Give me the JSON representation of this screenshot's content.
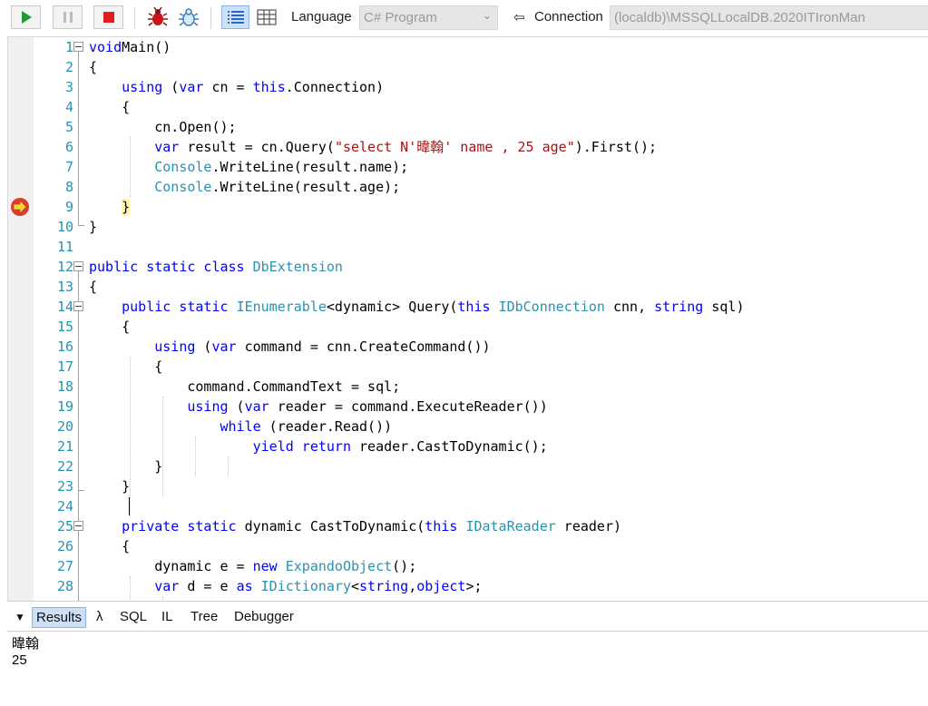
{
  "toolbar": {
    "language_label": "Language",
    "language_value": "C# Program",
    "connection_label": "Connection",
    "connection_value": "(localdb)\\MSSQLLocalDB.2020ITIronMan"
  },
  "editor": {
    "breakpoint_line": 9,
    "lines": [
      {
        "n": "1",
        "t": [
          [
            "kw",
            "void"
          ],
          [
            "",
            "Main()"
          ]
        ]
      },
      {
        "n": "2",
        "t": [
          [
            "",
            "{"
          ]
        ]
      },
      {
        "n": "3",
        "t": [
          [
            "",
            "    "
          ],
          [
            "kw",
            "using"
          ],
          [
            "",
            " ("
          ],
          [
            "kw",
            "var"
          ],
          [
            "",
            " cn = "
          ],
          [
            "kw",
            "this"
          ],
          [
            "",
            ".Connection)"
          ]
        ]
      },
      {
        "n": "4",
        "t": [
          [
            "",
            "    {"
          ]
        ]
      },
      {
        "n": "5",
        "t": [
          [
            "",
            "        cn.Open();"
          ]
        ]
      },
      {
        "n": "6",
        "t": [
          [
            "",
            "        "
          ],
          [
            "kw",
            "var"
          ],
          [
            "",
            " result = cn.Query("
          ],
          [
            "str",
            "\"select N'暐翰' name , 25 age\""
          ],
          [
            "",
            ").First();"
          ]
        ]
      },
      {
        "n": "7",
        "t": [
          [
            "",
            "        "
          ],
          [
            "ty",
            "Console"
          ],
          [
            "",
            ".WriteLine(result.name);"
          ]
        ]
      },
      {
        "n": "8",
        "t": [
          [
            "",
            "        "
          ],
          [
            "ty",
            "Console"
          ],
          [
            "",
            ".WriteLine(result.age);"
          ]
        ]
      },
      {
        "n": "9",
        "t": [
          [
            "",
            "    "
          ],
          [
            "hl",
            "}"
          ]
        ]
      },
      {
        "n": "10",
        "t": [
          [
            "",
            "}"
          ]
        ]
      },
      {
        "n": "11",
        "t": []
      },
      {
        "n": "12",
        "t": [
          [
            "kw",
            "public static class"
          ],
          [
            "",
            " "
          ],
          [
            "ty",
            "DbExtension"
          ]
        ]
      },
      {
        "n": "13",
        "t": [
          [
            "",
            "{"
          ]
        ]
      },
      {
        "n": "14",
        "t": [
          [
            "",
            "    "
          ],
          [
            "kw",
            "public static"
          ],
          [
            "",
            " "
          ],
          [
            "ty",
            "IEnumerable"
          ],
          [
            "",
            "<dynamic> Query("
          ],
          [
            "kw",
            "this"
          ],
          [
            "",
            " "
          ],
          [
            "ty",
            "IDbConnection"
          ],
          [
            "",
            " cnn, "
          ],
          [
            "kw",
            "string"
          ],
          [
            "",
            " sql)"
          ]
        ]
      },
      {
        "n": "15",
        "t": [
          [
            "",
            "    {"
          ]
        ]
      },
      {
        "n": "16",
        "t": [
          [
            "",
            "        "
          ],
          [
            "kw",
            "using"
          ],
          [
            "",
            " ("
          ],
          [
            "kw",
            "var"
          ],
          [
            "",
            " command = cnn.CreateCommand())"
          ]
        ]
      },
      {
        "n": "17",
        "t": [
          [
            "",
            "        {"
          ]
        ]
      },
      {
        "n": "18",
        "t": [
          [
            "",
            "            command.CommandText = sql;"
          ]
        ]
      },
      {
        "n": "19",
        "t": [
          [
            "",
            "            "
          ],
          [
            "kw",
            "using"
          ],
          [
            "",
            " ("
          ],
          [
            "kw",
            "var"
          ],
          [
            "",
            " reader = command.ExecuteReader())"
          ]
        ]
      },
      {
        "n": "20",
        "t": [
          [
            "",
            "                "
          ],
          [
            "kw",
            "while"
          ],
          [
            "",
            " (reader.Read())"
          ]
        ]
      },
      {
        "n": "21",
        "t": [
          [
            "",
            "                    "
          ],
          [
            "kw",
            "yield return"
          ],
          [
            "",
            " reader.CastToDynamic();"
          ]
        ]
      },
      {
        "n": "22",
        "t": [
          [
            "",
            "        }"
          ]
        ]
      },
      {
        "n": "23",
        "t": [
          [
            "",
            "    }"
          ]
        ]
      },
      {
        "n": "24",
        "t": []
      },
      {
        "n": "25",
        "t": [
          [
            "",
            "    "
          ],
          [
            "kw",
            "private static"
          ],
          [
            "",
            " dynamic CastToDynamic("
          ],
          [
            "kw",
            "this"
          ],
          [
            "",
            " "
          ],
          [
            "ty",
            "IDataReader"
          ],
          [
            "",
            " reader)"
          ]
        ]
      },
      {
        "n": "26",
        "t": [
          [
            "",
            "    {"
          ]
        ]
      },
      {
        "n": "27",
        "t": [
          [
            "",
            "        dynamic e = "
          ],
          [
            "kw",
            "new"
          ],
          [
            "",
            " "
          ],
          [
            "ty",
            "ExpandoObject"
          ],
          [
            "",
            "();"
          ]
        ]
      },
      {
        "n": "28",
        "t": [
          [
            "",
            "        "
          ],
          [
            "kw",
            "var"
          ],
          [
            "",
            " d = e "
          ],
          [
            "kw",
            "as"
          ],
          [
            "",
            " "
          ],
          [
            "ty",
            "IDictionary"
          ],
          [
            "",
            "<"
          ],
          [
            "kw",
            "string"
          ],
          [
            "",
            ","
          ],
          [
            "kw",
            "object"
          ],
          [
            "",
            ">;"
          ]
        ]
      }
    ]
  },
  "results": {
    "tabs": [
      {
        "id": "results",
        "label": "Results",
        "selected": true
      },
      {
        "id": "lambda",
        "label": "λ",
        "selected": false
      },
      {
        "id": "sql",
        "label": "SQL",
        "selected": false
      },
      {
        "id": "il",
        "label": "IL",
        "selected": false
      },
      {
        "id": "tree",
        "label": "Tree",
        "selected": false
      },
      {
        "id": "debugger",
        "label": "Debugger",
        "selected": false
      }
    ],
    "output": [
      "暐翰",
      "25"
    ]
  }
}
